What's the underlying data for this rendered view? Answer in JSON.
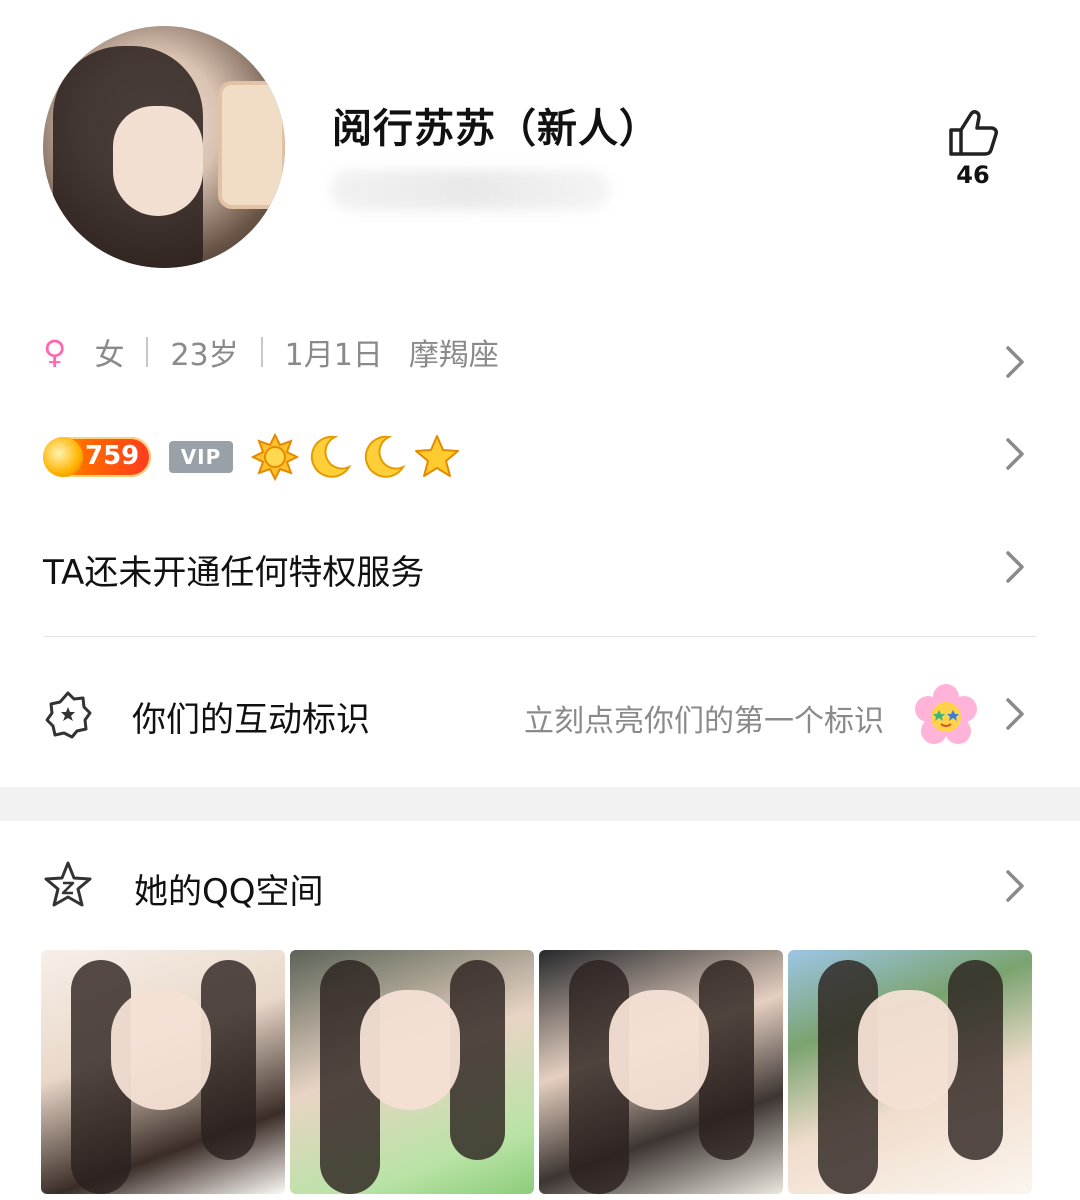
{
  "profile": {
    "name": "阅行苏苏（新人）",
    "likes": "46"
  },
  "info": {
    "gender": "女",
    "age": "23岁",
    "birthday": "1月1日",
    "zodiac": "摩羯座"
  },
  "badges": {
    "level": "759",
    "vip": "VIP",
    "level_icons": [
      "sun-icon",
      "moon-icon",
      "moon-icon",
      "star-icon"
    ]
  },
  "privilege": {
    "text": "TA还未开通任何特权服务"
  },
  "interaction": {
    "label": "你们的互动标识",
    "hint": "立刻点亮你们的第一个标识"
  },
  "qzone": {
    "label": "她的QQ空间",
    "photos": [
      "photo-1",
      "photo-2",
      "photo-3",
      "photo-4"
    ]
  },
  "colors": {
    "accent_pink": "#ff67b0",
    "level_orange": "#ff6a00",
    "vip_gray": "#9aa0a8",
    "muted_text": "#8a8a8a",
    "section_gap": "#f2f2f2"
  }
}
